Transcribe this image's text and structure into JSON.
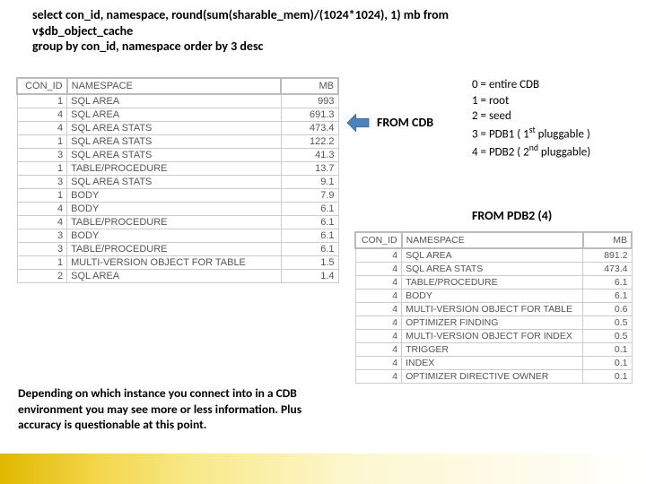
{
  "sql": {
    "line1": "select con_id, namespace, round(sum(sharable_mem)/(1024*1024), 1) mb from",
    "line2": "v$db_object_cache",
    "line3": "group by con_id, namespace order by 3 desc"
  },
  "labels": {
    "from_cdb": "FROM CDB",
    "from_pdb2": "FROM PDB2 (4)"
  },
  "legend": {
    "l0": "0 = entire CDB",
    "l1": "1 = root",
    "l2": "2 = seed",
    "l3a": "3 = PDB1 ( 1",
    "l3b": " pluggable )",
    "l4a": "4 = PDB2 ( 2",
    "l4b": " pluggable)",
    "st": "st",
    "nd": "nd"
  },
  "caption": "Depending on which instance you connect into in a CDB environment you may see more or less information. Plus accuracy is questionable at this point.",
  "table1": {
    "headers": {
      "c1": "CON_ID",
      "c2": "NAMESPACE",
      "c3": "MB"
    },
    "rows": [
      {
        "c1": "1",
        "c2": "SQL AREA",
        "c3": "993"
      },
      {
        "c1": "4",
        "c2": "SQL AREA",
        "c3": "691.3"
      },
      {
        "c1": "4",
        "c2": "SQL AREA STATS",
        "c3": "473.4"
      },
      {
        "c1": "1",
        "c2": "SQL AREA STATS",
        "c3": "122.2"
      },
      {
        "c1": "3",
        "c2": "SQL AREA STATS",
        "c3": "41.3"
      },
      {
        "c1": "1",
        "c2": "TABLE/PROCEDURE",
        "c3": "13.7"
      },
      {
        "c1": "3",
        "c2": "SQL AREA STATS",
        "c3": "9.1"
      },
      {
        "c1": "1",
        "c2": "BODY",
        "c3": "7.9"
      },
      {
        "c1": "4",
        "c2": "BODY",
        "c3": "6.1"
      },
      {
        "c1": "4",
        "c2": "TABLE/PROCEDURE",
        "c3": "6.1"
      },
      {
        "c1": "3",
        "c2": "BODY",
        "c3": "6.1"
      },
      {
        "c1": "3",
        "c2": "TABLE/PROCEDURE",
        "c3": "6.1"
      },
      {
        "c1": "1",
        "c2": "MULTI-VERSION OBJECT FOR TABLE",
        "c3": "1.5"
      },
      {
        "c1": "2",
        "c2": "SQL AREA",
        "c3": "1.4"
      }
    ]
  },
  "table2": {
    "headers": {
      "c1": "CON_ID",
      "c2": "NAMESPACE",
      "c3": "MB"
    },
    "rows": [
      {
        "c1": "4",
        "c2": "SQL AREA",
        "c3": "891.2"
      },
      {
        "c1": "4",
        "c2": "SQL AREA STATS",
        "c3": "473.4"
      },
      {
        "c1": "4",
        "c2": "TABLE/PROCEDURE",
        "c3": "6.1"
      },
      {
        "c1": "4",
        "c2": "BODY",
        "c3": "6.1"
      },
      {
        "c1": "4",
        "c2": "MULTI-VERSION OBJECT FOR TABLE",
        "c3": "0.6"
      },
      {
        "c1": "4",
        "c2": "OPTIMIZER FINDING",
        "c3": "0.5"
      },
      {
        "c1": "4",
        "c2": "MULTI-VERSION OBJECT FOR INDEX",
        "c3": "0.5"
      },
      {
        "c1": "4",
        "c2": "TRIGGER",
        "c3": "0.1"
      },
      {
        "c1": "4",
        "c2": "INDEX",
        "c3": "0.1"
      },
      {
        "c1": "4",
        "c2": "OPTIMIZER DIRECTIVE OWNER",
        "c3": "0.1"
      }
    ]
  }
}
